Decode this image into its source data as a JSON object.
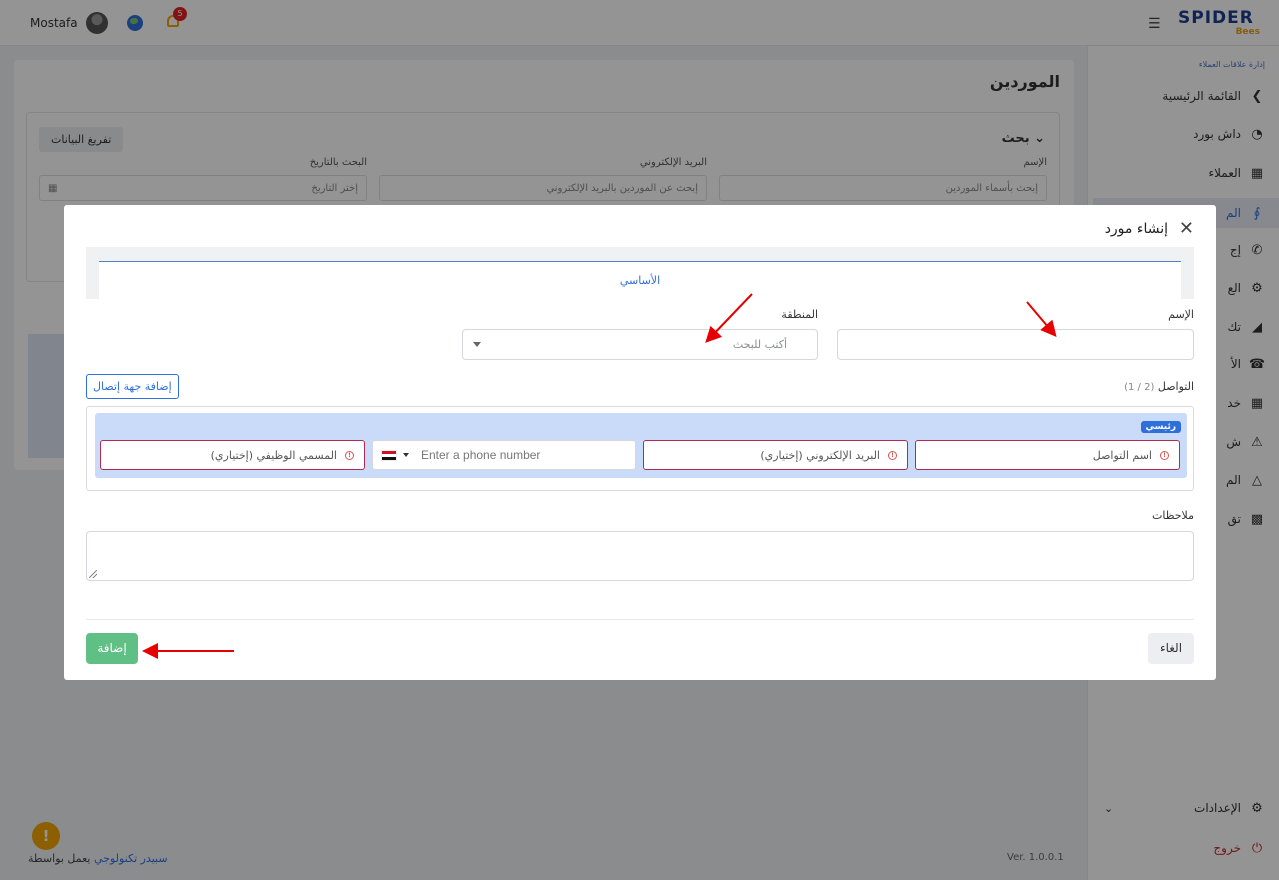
{
  "header": {
    "user_name": "Mostafa",
    "notification_count": "5"
  },
  "brand": {
    "name": "SPIDER",
    "sub": "Bees"
  },
  "sidebar": {
    "caption": "إدارة علاقات العملاء",
    "items": [
      {
        "label": "القائمة الرئيسية",
        "icon": "chevron-left-icon"
      },
      {
        "label": "داش بورد",
        "icon": "gauge-icon"
      },
      {
        "label": "العملاء",
        "icon": "building-icon"
      },
      {
        "label": "الم",
        "icon": "supplier-icon"
      },
      {
        "label": "إج",
        "icon": "phone-icon"
      },
      {
        "label": "الع",
        "icon": "gear-cycle-icon"
      },
      {
        "label": "تك",
        "icon": "filter-x-icon"
      },
      {
        "label": "الأ",
        "icon": "telephone-icon"
      },
      {
        "label": "خد",
        "icon": "calculator-icon"
      },
      {
        "label": "ش",
        "icon": "warning-icon"
      },
      {
        "label": "الم",
        "icon": "triangle-icon"
      },
      {
        "label": "تق",
        "icon": "bar-chart-icon"
      }
    ],
    "settings_label": "الإعدادات",
    "logout_label": "خروج"
  },
  "page": {
    "title": "الموردين",
    "search_title": "بحث",
    "clear_button": "تفريغ البيانات",
    "name_label": "الإسم",
    "name_placeholder": "إبحث بأسماء الموردين",
    "email_label": "البريد الإلكتروني",
    "email_placeholder": "إبحث عن الموردين بالبريد الإلكتروني",
    "date_label": "البحث بالتاريخ",
    "date_placeholder": "إختر التاريخ"
  },
  "footer": {
    "powered": "يعمل بواسطة",
    "company": "سبيدر تكنولوجي",
    "version": "Ver. 1.0.0.1"
  },
  "modal": {
    "title": "إنشاء مورد",
    "tab_basic": "الأساسي",
    "name_label": "الإسم",
    "region_label": "المنطقة",
    "region_placeholder": "أكتب للبحث",
    "contacts_label": "التواصل",
    "contacts_count": "(1 / 2)",
    "add_contact_button": "إضافة جهة إتصال",
    "main_badge": "رئيسي",
    "contact_name_placeholder": "اسم التواصل",
    "contact_email_placeholder": "البريد الإلكتروني (إختياري)",
    "phone_placeholder": "Enter a phone number",
    "job_title_placeholder": "المسمي الوظيفي (إختياري)",
    "notes_label": "ملاحظات",
    "add_button": "إضافة",
    "cancel_button": "الغاء"
  },
  "colors": {
    "primary": "#2f6fdc",
    "success": "#5fbf85",
    "error": "#b5294e",
    "annotation": "#e60000"
  }
}
